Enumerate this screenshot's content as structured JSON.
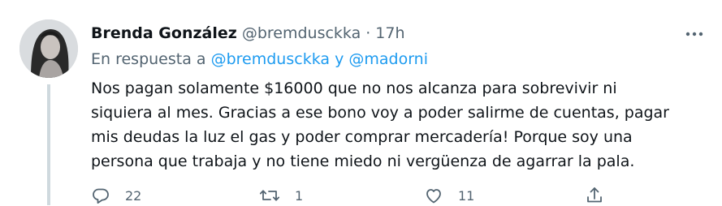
{
  "tweet": {
    "author_name": "Brenda González",
    "author_handle": "@bremdusckka",
    "separator": "·",
    "timestamp": "17h",
    "reply_prefix": "En respuesta a",
    "reply_mention_1": "@bremdusckka",
    "reply_conjunction": "y",
    "reply_mention_2": "@madorni",
    "body_lines": [
      "Nos pagan solamente $16000 que no nos alcanza para sobrevivir ni",
      "siquiera al mes. Gracias a ese bono voy a poder salirme de cuentas, pagar",
      "mis deudas la luz el gas y poder comprar mercadería! Porque soy una",
      "persona que trabaja y no tiene miedo ni vergüenza de agarrar la pala."
    ],
    "reply_count": "22",
    "retweet_count": "1",
    "like_count": "11"
  },
  "icons": {
    "more": "more-horizontal-icon",
    "reply": "reply-bubble-icon",
    "retweet": "retweet-arrows-icon",
    "like": "heart-icon",
    "share": "share-upload-icon"
  },
  "colors": {
    "text": "#0f1419",
    "secondary": "#536471",
    "link": "#1d9bf0",
    "thread_line": "#cfd9de"
  }
}
